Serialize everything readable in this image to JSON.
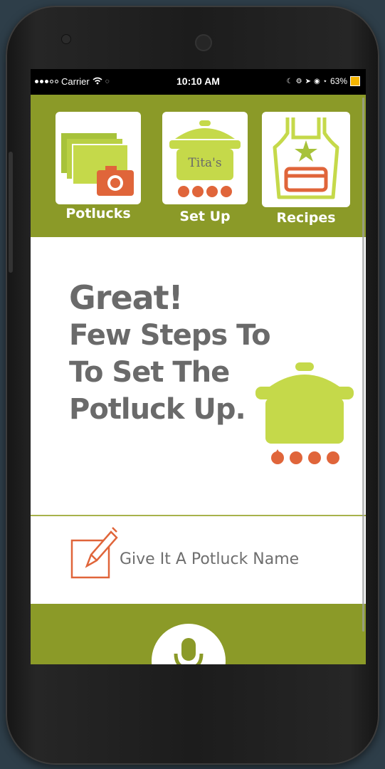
{
  "statusbar": {
    "carrier": "Carrier",
    "time": "10:10 AM",
    "battery": "63%"
  },
  "nav": {
    "tiles": [
      {
        "label": "Potlucks",
        "icon": "photo-stack-icon"
      },
      {
        "label": "Set Up",
        "icon": "pot-icon",
        "pot_text": "Tita's"
      },
      {
        "label": "Recipes",
        "icon": "apron-icon"
      }
    ]
  },
  "main": {
    "headline_1": "Great!",
    "headline_2": "Few Steps To",
    "headline_3": "To Set The",
    "headline_4": "Potluck Up.",
    "name_label": "Give It A Potluck Name"
  },
  "colors": {
    "olive": "#8b9a28",
    "lime": "#c5d94a",
    "orange": "#e0653a",
    "text_gray": "#6a6a6a"
  },
  "bottom": {
    "mic": "microphone-icon"
  }
}
